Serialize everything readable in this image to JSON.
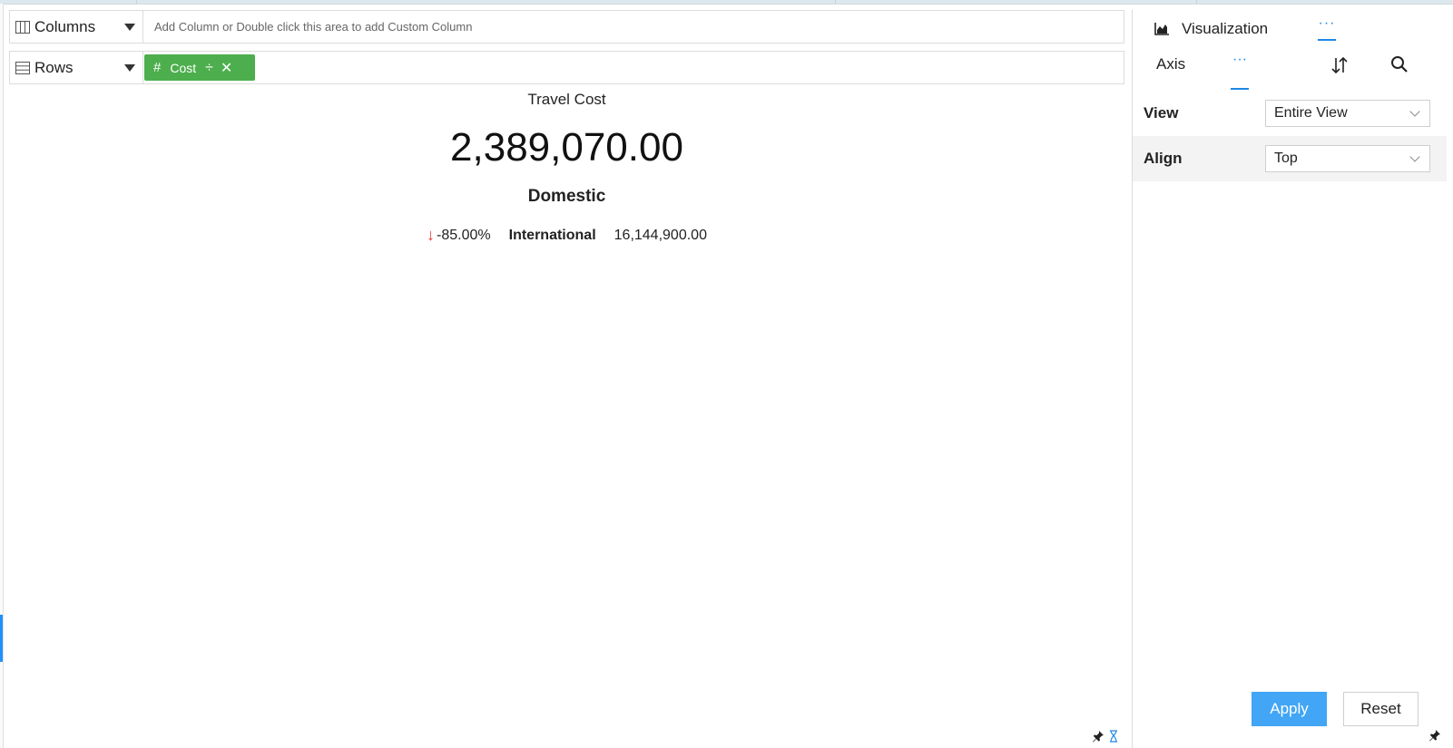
{
  "shelves": {
    "columns": {
      "label": "Columns",
      "placeholder": "Add Column or Double click this area to add Custom Column"
    },
    "rows": {
      "label": "Rows",
      "pill": {
        "label": "Cost",
        "type_icon": "hash-icon"
      }
    }
  },
  "kpi": {
    "title": "Travel Cost",
    "value": "2,389,070.00",
    "subtitle": "Domestic",
    "change": "-85.00%",
    "change_direction": "down",
    "compare_label": "International",
    "compare_value": "16,144,900.00",
    "colors": {
      "down_arrow": "#e53935"
    }
  },
  "panel": {
    "tab_label": "Visualization",
    "tab_more": "···",
    "subtab_axis": "Axis",
    "subtab_more": "···",
    "properties": [
      {
        "label": "View",
        "value": "Entire View"
      },
      {
        "label": "Align",
        "value": "Top"
      }
    ],
    "apply_label": "Apply",
    "reset_label": "Reset"
  },
  "colors": {
    "accent": "#1e88e5",
    "pill_green": "#4cae4c",
    "apply_blue": "#42a5f5"
  }
}
